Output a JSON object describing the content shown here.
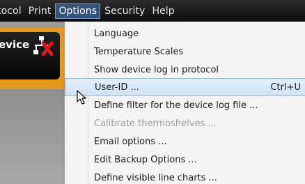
{
  "menubar": {
    "items": [
      {
        "label": "tocol"
      },
      {
        "label": "Print"
      },
      {
        "label": "Options"
      },
      {
        "label": "Security"
      },
      {
        "label": "Help"
      }
    ]
  },
  "background": {
    "device_label": "evice"
  },
  "options_menu": {
    "items": [
      {
        "label": "Language",
        "shortcut": ""
      },
      {
        "label": "Temperature Scales",
        "shortcut": ""
      },
      {
        "label": "Show device log in protocol",
        "shortcut": ""
      },
      {
        "label": "User-ID ...",
        "shortcut": "Ctrl+U"
      },
      {
        "label": "Define filter for the device log file ...",
        "shortcut": ""
      },
      {
        "label": "Calibrate thermoshelves ...",
        "shortcut": ""
      },
      {
        "label": "Email options ...",
        "shortcut": ""
      },
      {
        "label": "Edit Backup Options ...",
        "shortcut": ""
      },
      {
        "label": "Define visible line charts ...",
        "shortcut": ""
      }
    ]
  }
}
